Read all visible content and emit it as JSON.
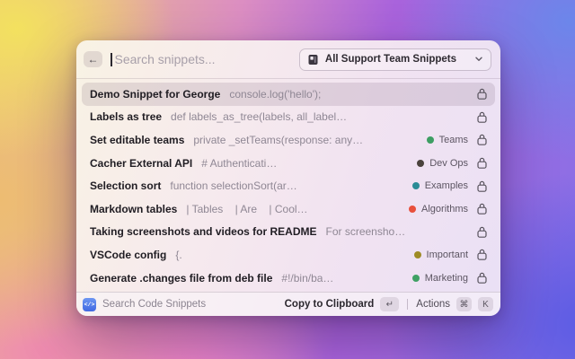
{
  "window": {
    "search": {
      "placeholder": "Search snippets..."
    },
    "dropdown": {
      "label": "All Support Team Snippets"
    },
    "rows": [
      {
        "title": "Demo Snippet for George",
        "subtitle": "console.log('hello');",
        "selected": true
      },
      {
        "title": "Labels as tree",
        "subtitle": "def labels_as_tree(labels, all_label…"
      },
      {
        "title": "Set editable teams",
        "subtitle": "private _setTeams(response: any…",
        "tag": {
          "label": "Teams",
          "color": "#3D9E63"
        }
      },
      {
        "title": "Cacher External API",
        "subtitle": "# Authenticati…",
        "tag": {
          "label": "Dev Ops",
          "color": "#4A423C"
        }
      },
      {
        "title": "Selection sort",
        "subtitle": "function selectionSort(ar…",
        "tag": {
          "label": "Examples",
          "color": "#2A8C96"
        }
      },
      {
        "title": "Markdown tables",
        "subtitle": "| Tables    | Are    | Cool…",
        "tag": {
          "label": "Algorithms",
          "color": "#E8503C"
        }
      },
      {
        "title": "Taking screenshots and videos for README",
        "subtitle": "For screensho…"
      },
      {
        "title": "VSCode config",
        "subtitle": "{.",
        "tag": {
          "label": "Important",
          "color": "#9E8B25"
        }
      },
      {
        "title": "Generate .changes file from deb file",
        "subtitle": "#!/bin/ba…",
        "tag": {
          "label": "Marketing",
          "color": "#3FA164"
        }
      }
    ],
    "footer": {
      "app_icon": "</>",
      "app_label": "Search Code Snippets",
      "primary_action": "Copy to Clipboard",
      "primary_key": "↵",
      "secondary_action": "Actions",
      "secondary_keys": [
        "⌘",
        "K"
      ]
    }
  }
}
